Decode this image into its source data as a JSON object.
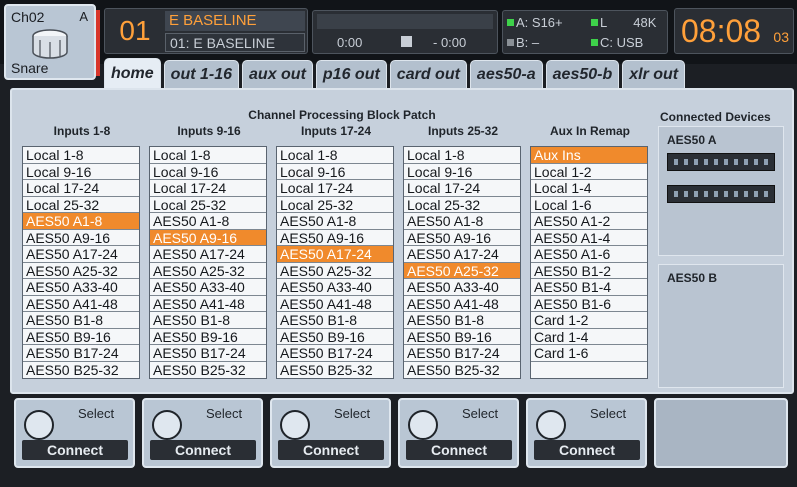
{
  "channel": {
    "name": "Ch02",
    "letter": "A",
    "label": "Snare",
    "icon": "snare-drum-icon"
  },
  "scene": {
    "number": "01",
    "title": "E BASELINE",
    "subtitle": "01: E BASELINE"
  },
  "transport": {
    "elapsed": "0:00",
    "remaining": "- 0:00",
    "stop_icon": "stop-icon"
  },
  "status": {
    "a": "A: S16+",
    "b": "B: –",
    "l": "L",
    "rate": "48K",
    "c": "C: USB"
  },
  "clock": {
    "hours_minutes": "08:08",
    "seconds": "03"
  },
  "tabs": [
    "home",
    "out 1-16",
    "aux out",
    "p16 out",
    "card out",
    "aes50-a",
    "aes50-b",
    "xlr out"
  ],
  "panel": {
    "title": "Channel Processing Block Patch",
    "columns": [
      {
        "header": "Inputs 1-8",
        "selected": 4,
        "items": [
          "Local 1-8",
          "Local 9-16",
          "Local 17-24",
          "Local 25-32",
          "AES50 A1-8",
          "AES50 A9-16",
          "AES50 A17-24",
          "AES50 A25-32",
          "AES50 A33-40",
          "AES50 A41-48",
          "AES50 B1-8",
          "AES50 B9-16",
          "AES50 B17-24",
          "AES50 B25-32"
        ]
      },
      {
        "header": "Inputs 9-16",
        "selected": 5,
        "items": [
          "Local 1-8",
          "Local 9-16",
          "Local 17-24",
          "Local 25-32",
          "AES50 A1-8",
          "AES50 A9-16",
          "AES50 A17-24",
          "AES50 A25-32",
          "AES50 A33-40",
          "AES50 A41-48",
          "AES50 B1-8",
          "AES50 B9-16",
          "AES50 B17-24",
          "AES50 B25-32"
        ]
      },
      {
        "header": "Inputs 17-24",
        "selected": 6,
        "items": [
          "Local 1-8",
          "Local 9-16",
          "Local 17-24",
          "Local 25-32",
          "AES50 A1-8",
          "AES50 A9-16",
          "AES50 A17-24",
          "AES50 A25-32",
          "AES50 A33-40",
          "AES50 A41-48",
          "AES50 B1-8",
          "AES50 B9-16",
          "AES50 B17-24",
          "AES50 B25-32"
        ]
      },
      {
        "header": "Inputs 25-32",
        "selected": 7,
        "items": [
          "Local 1-8",
          "Local 9-16",
          "Local 17-24",
          "Local 25-32",
          "AES50 A1-8",
          "AES50 A9-16",
          "AES50 A17-24",
          "AES50 A25-32",
          "AES50 A33-40",
          "AES50 A41-48",
          "AES50 B1-8",
          "AES50 B9-16",
          "AES50 B17-24",
          "AES50 B25-32"
        ]
      },
      {
        "header": "Aux In Remap",
        "selected": 0,
        "items": [
          "Aux Ins",
          "Local 1-2",
          "Local 1-4",
          "Local 1-6",
          "AES50 A1-2",
          "AES50 A1-4",
          "AES50 A1-6",
          "AES50 B1-2",
          "AES50 B1-4",
          "AES50 B1-6",
          "Card 1-2",
          "Card 1-4",
          "Card 1-6",
          ""
        ]
      }
    ],
    "devices_title": "Connected Devices",
    "device_a": "AES50 A",
    "device_b": "AES50 B"
  },
  "bottom": {
    "select_label": "Select",
    "connect_label": "Connect",
    "knob_icon": "encoder-knob-icon"
  },
  "colors": {
    "accent": "#ffa03a",
    "selected": "#f08a2c",
    "panel": "#c6d0dc"
  }
}
